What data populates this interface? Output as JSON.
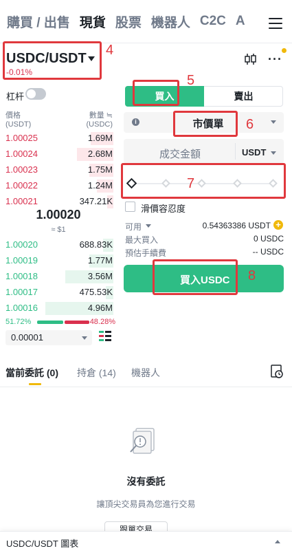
{
  "nav": {
    "tabs": [
      "購買 / 出售",
      "現貨",
      "股票",
      "機器人",
      "C2C",
      "A"
    ],
    "active": 1
  },
  "pair": {
    "name": "USDC/USDT",
    "change": "-0.01%"
  },
  "leverage_label": "杠杆",
  "orderbook": {
    "price_header": "價格",
    "price_unit": "(USDT)",
    "qty_header": "數量 ≒",
    "qty_unit": "(USDC)",
    "asks": [
      {
        "price": "1.00025",
        "qty": "1.69M",
        "depth": 0.3
      },
      {
        "price": "1.00024",
        "qty": "2.68M",
        "depth": 0.48
      },
      {
        "price": "1.00023",
        "qty": "1.75M",
        "depth": 0.32
      },
      {
        "price": "1.00022",
        "qty": "1.24M",
        "depth": 0.22
      },
      {
        "price": "1.00021",
        "qty": "347.21K",
        "depth": 0.08
      }
    ],
    "mid_price": "1.00020",
    "mid_usd": "≈ $1",
    "bids": [
      {
        "price": "1.00020",
        "qty": "688.83K",
        "depth": 0.14
      },
      {
        "price": "1.00019",
        "qty": "1.77M",
        "depth": 0.32
      },
      {
        "price": "1.00018",
        "qty": "3.56M",
        "depth": 0.64
      },
      {
        "price": "1.00017",
        "qty": "475.53K",
        "depth": 0.1
      },
      {
        "price": "1.00016",
        "qty": "4.96M",
        "depth": 0.9
      }
    ],
    "buy_ratio": "51.72%",
    "sell_ratio": "48.28%",
    "buy_share": 0.5172,
    "precision": "0.00001"
  },
  "form": {
    "buy_tab": "買入",
    "sell_tab": "賣出",
    "order_type": "市價單",
    "amount_placeholder": "成交金額",
    "amount_unit": "USDT",
    "slippage_label": "滑價容忍度",
    "available_label": "可用",
    "available_value": "0.54363386 USDT",
    "max_buy_label": "最大買入",
    "max_buy_value": "0 USDC",
    "fee_label": "預估手續費",
    "fee_value": "-- USDC",
    "buy_button": "買入USDC",
    "slider_value": 0
  },
  "annotations": [
    "4",
    "5",
    "6",
    "7",
    "8"
  ],
  "orders": {
    "tabs": [
      "當前委託 (0)",
      "持倉 (14)",
      "機器人"
    ],
    "empty_title": "沒有委託",
    "empty_sub": "讓頂尖交易員為您進行交易",
    "follow_button": "跟單交易"
  },
  "bottom_bar": {
    "label": "USDC/USDT 圖表"
  },
  "colors": {
    "buy": "#2ebd85",
    "sell": "#d9304e",
    "accent": "#f0b90b",
    "annotation": "#e0383d"
  }
}
